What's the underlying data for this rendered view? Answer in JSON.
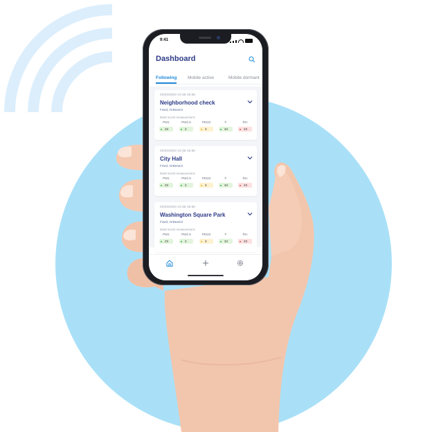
{
  "colors": {
    "background": "#ffffff",
    "circle": "#a9e0f8",
    "waves": "#dceefc",
    "title": "#2c3a86",
    "accent": "#1f8ad8",
    "good": "#e2f4dc",
    "good_dot": "#3cb14a",
    "moderate": "#fdf1cf",
    "moderate_dot": "#f0b429",
    "bad": "#fde0e0",
    "bad_dot": "#e0474c"
  },
  "status_bar": {
    "time": "9:41"
  },
  "header": {
    "title": "Dashboard",
    "search_icon": "search-person-icon"
  },
  "tabs": [
    {
      "label": "Following",
      "active": true
    },
    {
      "label": "Mobile active",
      "active": false
    },
    {
      "label": "Mobile dormant",
      "active": false
    }
  ],
  "sessions": [
    {
      "date": "03/20/2020 10:35-15:56",
      "name": "Neighborhood check",
      "subtitle": "Fixed, AirBeam3",
      "recent_label": "Most recent measurement:",
      "measurements": [
        {
          "label": "PM1",
          "value": "23",
          "level": "good"
        },
        {
          "label": "PM2.5",
          "value": "2",
          "level": "good"
        },
        {
          "label": "PM10",
          "value": "3",
          "level": "moderate"
        },
        {
          "label": "F",
          "value": "34",
          "level": "good"
        },
        {
          "label": "RH",
          "value": "23",
          "level": "bad"
        }
      ]
    },
    {
      "date": "03/20/2020 10:35-15:56",
      "name": "City Hall",
      "subtitle": "Fixed, AirBeam3",
      "recent_label": "Most recent measurement:",
      "measurements": [
        {
          "label": "PM1",
          "value": "23",
          "level": "good"
        },
        {
          "label": "PM2.5",
          "value": "2",
          "level": "good"
        },
        {
          "label": "PM10",
          "value": "3",
          "level": "moderate"
        },
        {
          "label": "F",
          "value": "34",
          "level": "good"
        },
        {
          "label": "RH",
          "value": "23",
          "level": "bad"
        }
      ]
    },
    {
      "date": "03/20/2020 10:35-15:56",
      "name": "Washington Square Park",
      "subtitle": "Fixed, AirBeam3",
      "recent_label": "Most recent measurement:",
      "measurements": [
        {
          "label": "PM1",
          "value": "23",
          "level": "good"
        },
        {
          "label": "PM2.5",
          "value": "2",
          "level": "good"
        },
        {
          "label": "PM10",
          "value": "3",
          "level": "moderate"
        },
        {
          "label": "F",
          "value": "34",
          "level": "good"
        },
        {
          "label": "RH",
          "value": "23",
          "level": "bad"
        }
      ]
    }
  ],
  "navbar": [
    {
      "icon": "home-icon",
      "active": true
    },
    {
      "icon": "plus-icon",
      "active": false
    },
    {
      "icon": "settings-icon",
      "active": false
    }
  ]
}
